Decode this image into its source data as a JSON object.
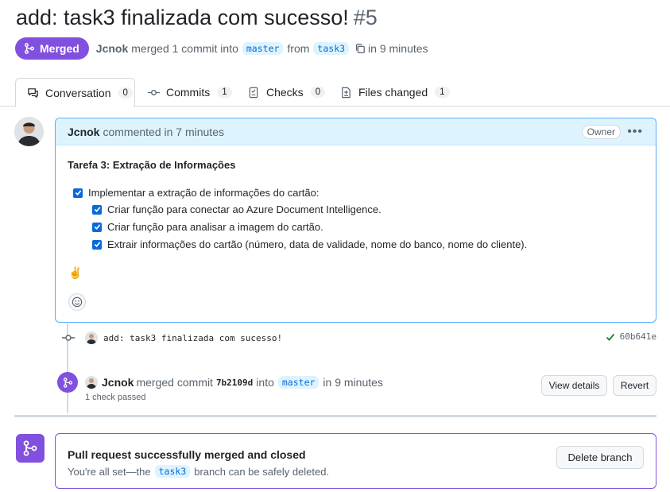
{
  "pr": {
    "title": "add: task3 finalizada com sucesso!",
    "number": "#5",
    "state_label": "Merged",
    "author": "Jcnok",
    "merged_text": "merged 1 commit into",
    "base_branch": "master",
    "from_text": "from",
    "head_branch": "task3",
    "time_text": "in 9 minutes"
  },
  "tabs": [
    {
      "label": "Conversation",
      "count": "0"
    },
    {
      "label": "Commits",
      "count": "1"
    },
    {
      "label": "Checks",
      "count": "0"
    },
    {
      "label": "Files changed",
      "count": "1"
    }
  ],
  "comment": {
    "author": "Jcnok",
    "meta": "commented in 7 minutes",
    "role_badge": "Owner",
    "heading": "Tarefa 3: Extração de Informações",
    "tasks": [
      "Implementar a extração de informações do cartão:",
      "Criar função para conectar ao Azure Document Intelligence.",
      "Criar função para analisar a imagem do cartão.",
      "Extrair informações do cartão (número, data de validade, nome do banco, nome do cliente)."
    ],
    "emoji": "✌️"
  },
  "commit": {
    "message": "add: task3 finalizada com sucesso!",
    "sha": "60b641e"
  },
  "merge_event": {
    "author": "Jcnok",
    "merged_commit_text": "merged commit",
    "sha": "7b2109d",
    "into_text": "into",
    "branch": "master",
    "time_text": "in 9 minutes",
    "checks": "1 check passed",
    "view_details_label": "View details",
    "revert_label": "Revert"
  },
  "merged_box": {
    "title": "Pull request successfully merged and closed",
    "sub_before": "You're all set—the",
    "branch": "task3",
    "sub_after": "branch can be safely deleted.",
    "delete_label": "Delete branch"
  },
  "colors": {
    "merged_purple": "#8250df",
    "link_blue": "#0969da",
    "comment_header_bg": "#ddf4ff",
    "success_green": "#1a7f37"
  }
}
